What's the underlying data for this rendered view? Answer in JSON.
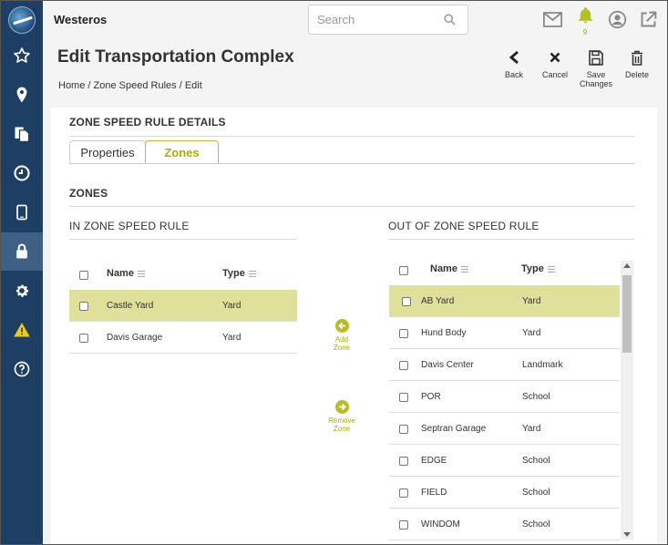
{
  "app": {
    "name": "Westeros"
  },
  "search": {
    "placeholder": "Search"
  },
  "notifications": {
    "count": "9"
  },
  "header": {
    "title": "Edit Transportation Complex",
    "breadcrumb": [
      "Home",
      "Zone Speed Rules",
      "Edit"
    ]
  },
  "actions": {
    "back": "Back",
    "cancel": "Cancel",
    "save": "Save Changes",
    "delete": "Delete"
  },
  "section": {
    "details_title": "ZONE SPEED RULE DETAILS",
    "zones_title": "ZONES"
  },
  "tabs": [
    {
      "label": "Properties",
      "active": false
    },
    {
      "label": "Zones",
      "active": true
    }
  ],
  "in_zone": {
    "title": "IN ZONE SPEED RULE",
    "columns": {
      "name": "Name",
      "type": "Type"
    },
    "rows": [
      {
        "name": "Castle Yard",
        "type": "Yard",
        "selected": true
      },
      {
        "name": "Davis Garage",
        "type": "Yard",
        "selected": false
      }
    ]
  },
  "out_zone": {
    "title": "OUT OF ZONE SPEED RULE",
    "columns": {
      "name": "Name",
      "type": "Type"
    },
    "rows": [
      {
        "name": "AB Yard",
        "type": "Yard",
        "selected": true
      },
      {
        "name": "Hund Body",
        "type": "Yard",
        "selected": false
      },
      {
        "name": "Davis Center",
        "type": "Landmark",
        "selected": false
      },
      {
        "name": "POR",
        "type": "School",
        "selected": false
      },
      {
        "name": "Septran Garage",
        "type": "Yard",
        "selected": false
      },
      {
        "name": "EDGE",
        "type": "School",
        "selected": false
      },
      {
        "name": "FIELD",
        "type": "School",
        "selected": false
      },
      {
        "name": "WINDOM",
        "type": "School",
        "selected": false
      }
    ]
  },
  "transfer": {
    "add": "Add Zone",
    "remove": "Remove Zone"
  },
  "colors": {
    "sidebar": "#1d3f63",
    "sidebar_active": "#3d6084",
    "accent": "#b5bf1f",
    "selected_row": "#dfe19b",
    "warning": "#f2c811"
  },
  "sidebar_icons": [
    "star-icon",
    "location-pin-icon",
    "documents-icon",
    "clock-icon",
    "tablet-icon",
    "lock-icon",
    "gear-icon",
    "warning-icon",
    "help-icon"
  ]
}
